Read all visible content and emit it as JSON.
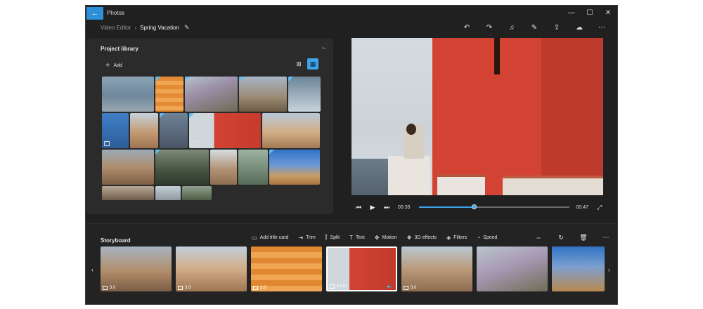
{
  "window": {
    "app_title": "Photos",
    "back_icon": "arrow-left-icon",
    "controls": [
      "—",
      "☐",
      "✕"
    ]
  },
  "breadcrumb": {
    "parent": "Video Editor",
    "current": "Spring Vacation"
  },
  "top_actions": [
    "↶",
    "↷",
    "♫",
    "✎",
    "⇪",
    "☁",
    "⋯"
  ],
  "library": {
    "title": "Project library",
    "add_label": "Add"
  },
  "player": {
    "current_time": "00:35",
    "total_time": "00:47",
    "progress": 0.37
  },
  "storyboard": {
    "title": "Storyboard",
    "tools": [
      {
        "icon": "▭",
        "label": "Add title card"
      },
      {
        "icon": "⇥",
        "label": "Trim"
      },
      {
        "icon": "⫿",
        "label": "Split"
      },
      {
        "icon": "T",
        "label": "Text"
      },
      {
        "icon": "✥",
        "label": "Motion"
      },
      {
        "icon": "❖",
        "label": "3D effects"
      },
      {
        "icon": "◈",
        "label": "Filters"
      },
      {
        "icon": "◔",
        "label": "Speed"
      }
    ],
    "icon_buttons": [
      "⇔",
      "↻",
      "🗑",
      "⋯"
    ],
    "clips": [
      {
        "duration": "3.0"
      },
      {
        "duration": "3.0"
      },
      {
        "duration": "3.0"
      },
      {
        "duration": "14.52"
      },
      {
        "duration": "3.0"
      },
      {
        "duration": ""
      },
      {
        "duration": ""
      }
    ]
  },
  "colors": {
    "accent": "#3ea3e8",
    "window_bg": "#202020",
    "panel_bg": "#2b2b2b"
  }
}
